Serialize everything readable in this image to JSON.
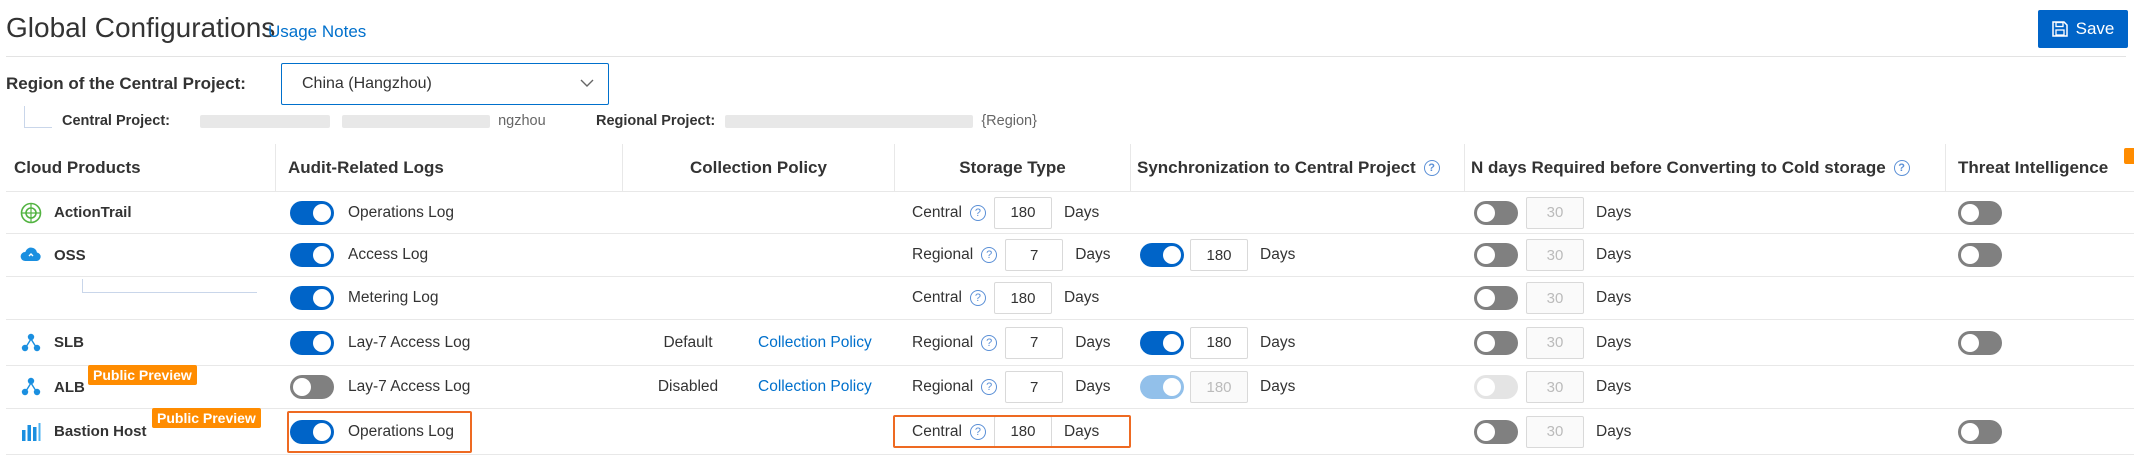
{
  "header": {
    "title": "Global Configurations",
    "usage_notes": "Usage Notes",
    "save_label": "Save"
  },
  "region": {
    "label": "Region of the Central Project:",
    "selected": "China (Hangzhou)",
    "central_project_label": "Central Project:",
    "central_project_suffix": "ngzhou",
    "regional_project_label": "Regional Project:",
    "regional_project_suffix": "{Region}"
  },
  "table": {
    "headers": {
      "products": "Cloud Products",
      "logs": "Audit-Related Logs",
      "policy": "Collection Policy",
      "storage": "Storage Type",
      "sync": "Synchronization to Central Project",
      "cold": "N days Required before Converting to Cold storage",
      "threat": "Threat Intelligence"
    },
    "days_label": "Days",
    "rows": [
      {
        "product": "ActionTrail",
        "badge": "",
        "log": "Operations Log",
        "log_toggle": "on",
        "policy": "",
        "policy_link": "",
        "storage": "Central",
        "storage_days": "180",
        "sync_toggle": "",
        "sync_days": "",
        "cold_toggle": "off",
        "cold_days": "30",
        "threat_toggle": "off"
      },
      {
        "product": "OSS",
        "badge": "",
        "log": "Access Log",
        "log_toggle": "on",
        "policy": "",
        "policy_link": "",
        "storage": "Regional",
        "storage_days": "7",
        "sync_toggle": "on",
        "sync_days": "180",
        "cold_toggle": "off",
        "cold_days": "30",
        "threat_toggle": "off"
      },
      {
        "product": "",
        "badge": "",
        "log": "Metering Log",
        "log_toggle": "on",
        "policy": "",
        "policy_link": "",
        "storage": "Central",
        "storage_days": "180",
        "sync_toggle": "",
        "sync_days": "",
        "cold_toggle": "off",
        "cold_days": "30",
        "threat_toggle": ""
      },
      {
        "product": "SLB",
        "badge": "",
        "log": "Lay-7 Access Log",
        "log_toggle": "on",
        "policy": "Default",
        "policy_link": "Collection Policy",
        "storage": "Regional",
        "storage_days": "7",
        "sync_toggle": "on",
        "sync_days": "180",
        "cold_toggle": "off",
        "cold_days": "30",
        "threat_toggle": "off"
      },
      {
        "product": "ALB",
        "badge": "Public Preview",
        "log": "Lay-7 Access Log",
        "log_toggle": "off",
        "policy": "Disabled",
        "policy_link": "Collection Policy",
        "storage": "Regional",
        "storage_days": "7",
        "sync_toggle": "on-dis",
        "sync_days": "180",
        "cold_toggle": "off-dis",
        "cold_days": "30",
        "threat_toggle": ""
      },
      {
        "product": "Bastion Host",
        "badge": "Public Preview",
        "log": "Operations Log",
        "log_toggle": "on",
        "policy": "",
        "policy_link": "",
        "storage": "Central",
        "storage_days": "180",
        "sync_toggle": "",
        "sync_days": "",
        "cold_toggle": "off",
        "cold_days": "30",
        "threat_toggle": "off"
      }
    ]
  },
  "colors": {
    "primary": "#0064c8",
    "link": "#0070cc",
    "badge": "#ff8c00",
    "highlight": "#ee6a22",
    "toggle_off": "#808080"
  }
}
